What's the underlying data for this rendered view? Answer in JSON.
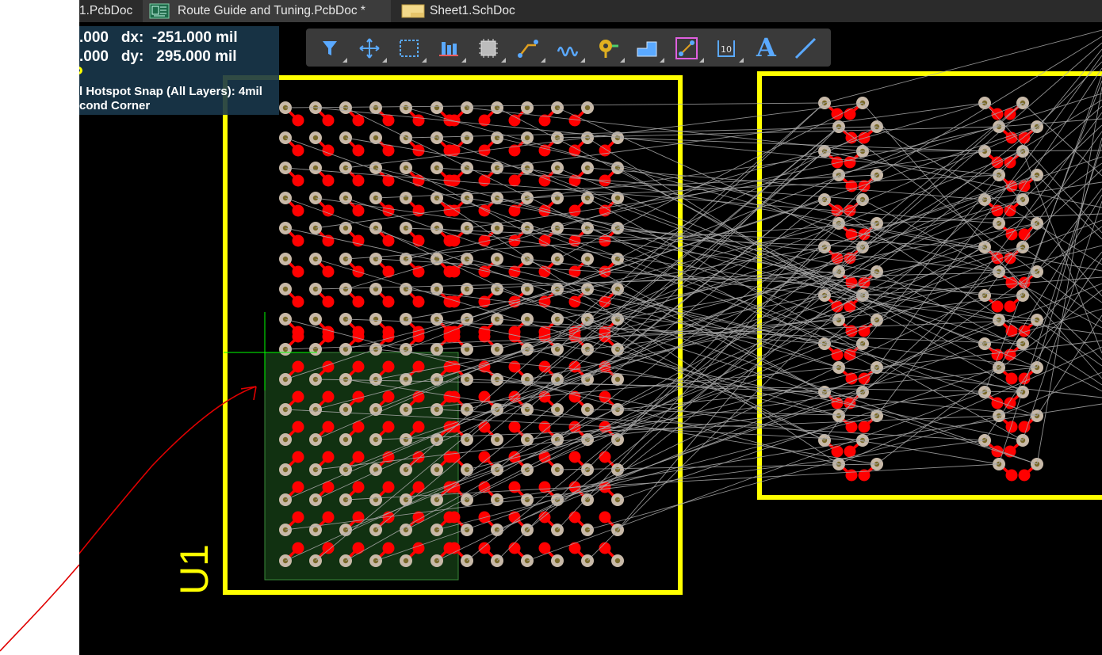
{
  "tabs": [
    {
      "label": "1.PcbDoc",
      "icon": "pcb-doc-icon",
      "active": false
    },
    {
      "label": "Route Guide and Tuning.PcbDoc *",
      "icon": "pcb-doc-icon",
      "active": true
    },
    {
      "label": "Sheet1.SchDoc",
      "icon": "sch-doc-icon",
      "active": false
    }
  ],
  "hud": {
    "line1": ".000   dx:  -251.000 mil",
    "line2": ".000   dy:   295.000 mil",
    "line3": "l Hotspot Snap (All Layers): 4mil",
    "line4": "cond Corner"
  },
  "toolbar": [
    {
      "icon": "filter-icon"
    },
    {
      "icon": "move-icon"
    },
    {
      "icon": "select-rect-icon"
    },
    {
      "icon": "align-icon"
    },
    {
      "icon": "component-icon"
    },
    {
      "icon": "route-icon"
    },
    {
      "icon": "tune-length-icon"
    },
    {
      "icon": "via-icon"
    },
    {
      "icon": "polygon-pour-icon"
    },
    {
      "icon": "interactive-route-icon"
    },
    {
      "icon": "dimension-icon"
    },
    {
      "icon": "text-icon",
      "text": "A"
    },
    {
      "icon": "line-icon"
    }
  ],
  "designator": "U1",
  "colors": {
    "tab_bar": "#2b2b2b",
    "canvas": "#000000",
    "outline": "#ffff00",
    "pad": "#c8b9a8",
    "pad_hole": "#7a6a2a",
    "pad_red": "#ff0000",
    "ratsnest": "#a8a8a8",
    "selection": "#1f5a1f",
    "cursor": "#00ff00",
    "annotation": "#e00000"
  }
}
